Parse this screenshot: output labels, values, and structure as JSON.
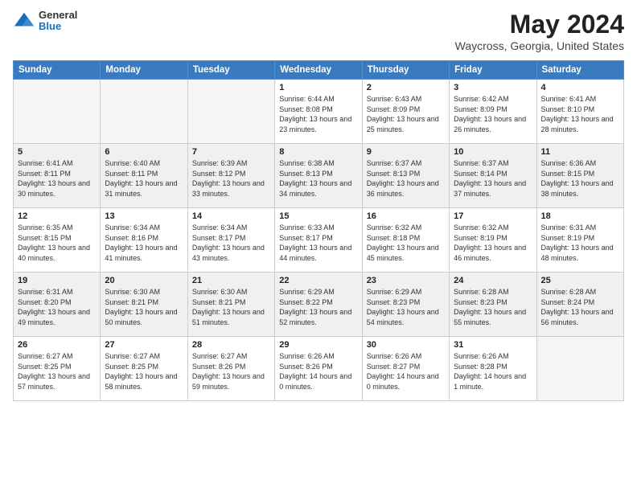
{
  "logo": {
    "general": "General",
    "blue": "Blue"
  },
  "header": {
    "title": "May 2024",
    "subtitle": "Waycross, Georgia, United States"
  },
  "weekdays": [
    "Sunday",
    "Monday",
    "Tuesday",
    "Wednesday",
    "Thursday",
    "Friday",
    "Saturday"
  ],
  "weeks": [
    [
      {
        "day": "",
        "info": ""
      },
      {
        "day": "",
        "info": ""
      },
      {
        "day": "",
        "info": ""
      },
      {
        "day": "1",
        "info": "Sunrise: 6:44 AM\nSunset: 8:08 PM\nDaylight: 13 hours and 23 minutes."
      },
      {
        "day": "2",
        "info": "Sunrise: 6:43 AM\nSunset: 8:09 PM\nDaylight: 13 hours and 25 minutes."
      },
      {
        "day": "3",
        "info": "Sunrise: 6:42 AM\nSunset: 8:09 PM\nDaylight: 13 hours and 26 minutes."
      },
      {
        "day": "4",
        "info": "Sunrise: 6:41 AM\nSunset: 8:10 PM\nDaylight: 13 hours and 28 minutes."
      }
    ],
    [
      {
        "day": "5",
        "info": "Sunrise: 6:41 AM\nSunset: 8:11 PM\nDaylight: 13 hours and 30 minutes."
      },
      {
        "day": "6",
        "info": "Sunrise: 6:40 AM\nSunset: 8:11 PM\nDaylight: 13 hours and 31 minutes."
      },
      {
        "day": "7",
        "info": "Sunrise: 6:39 AM\nSunset: 8:12 PM\nDaylight: 13 hours and 33 minutes."
      },
      {
        "day": "8",
        "info": "Sunrise: 6:38 AM\nSunset: 8:13 PM\nDaylight: 13 hours and 34 minutes."
      },
      {
        "day": "9",
        "info": "Sunrise: 6:37 AM\nSunset: 8:13 PM\nDaylight: 13 hours and 36 minutes."
      },
      {
        "day": "10",
        "info": "Sunrise: 6:37 AM\nSunset: 8:14 PM\nDaylight: 13 hours and 37 minutes."
      },
      {
        "day": "11",
        "info": "Sunrise: 6:36 AM\nSunset: 8:15 PM\nDaylight: 13 hours and 38 minutes."
      }
    ],
    [
      {
        "day": "12",
        "info": "Sunrise: 6:35 AM\nSunset: 8:15 PM\nDaylight: 13 hours and 40 minutes."
      },
      {
        "day": "13",
        "info": "Sunrise: 6:34 AM\nSunset: 8:16 PM\nDaylight: 13 hours and 41 minutes."
      },
      {
        "day": "14",
        "info": "Sunrise: 6:34 AM\nSunset: 8:17 PM\nDaylight: 13 hours and 43 minutes."
      },
      {
        "day": "15",
        "info": "Sunrise: 6:33 AM\nSunset: 8:17 PM\nDaylight: 13 hours and 44 minutes."
      },
      {
        "day": "16",
        "info": "Sunrise: 6:32 AM\nSunset: 8:18 PM\nDaylight: 13 hours and 45 minutes."
      },
      {
        "day": "17",
        "info": "Sunrise: 6:32 AM\nSunset: 8:19 PM\nDaylight: 13 hours and 46 minutes."
      },
      {
        "day": "18",
        "info": "Sunrise: 6:31 AM\nSunset: 8:19 PM\nDaylight: 13 hours and 48 minutes."
      }
    ],
    [
      {
        "day": "19",
        "info": "Sunrise: 6:31 AM\nSunset: 8:20 PM\nDaylight: 13 hours and 49 minutes."
      },
      {
        "day": "20",
        "info": "Sunrise: 6:30 AM\nSunset: 8:21 PM\nDaylight: 13 hours and 50 minutes."
      },
      {
        "day": "21",
        "info": "Sunrise: 6:30 AM\nSunset: 8:21 PM\nDaylight: 13 hours and 51 minutes."
      },
      {
        "day": "22",
        "info": "Sunrise: 6:29 AM\nSunset: 8:22 PM\nDaylight: 13 hours and 52 minutes."
      },
      {
        "day": "23",
        "info": "Sunrise: 6:29 AM\nSunset: 8:23 PM\nDaylight: 13 hours and 54 minutes."
      },
      {
        "day": "24",
        "info": "Sunrise: 6:28 AM\nSunset: 8:23 PM\nDaylight: 13 hours and 55 minutes."
      },
      {
        "day": "25",
        "info": "Sunrise: 6:28 AM\nSunset: 8:24 PM\nDaylight: 13 hours and 56 minutes."
      }
    ],
    [
      {
        "day": "26",
        "info": "Sunrise: 6:27 AM\nSunset: 8:25 PM\nDaylight: 13 hours and 57 minutes."
      },
      {
        "day": "27",
        "info": "Sunrise: 6:27 AM\nSunset: 8:25 PM\nDaylight: 13 hours and 58 minutes."
      },
      {
        "day": "28",
        "info": "Sunrise: 6:27 AM\nSunset: 8:26 PM\nDaylight: 13 hours and 59 minutes."
      },
      {
        "day": "29",
        "info": "Sunrise: 6:26 AM\nSunset: 8:26 PM\nDaylight: 14 hours and 0 minutes."
      },
      {
        "day": "30",
        "info": "Sunrise: 6:26 AM\nSunset: 8:27 PM\nDaylight: 14 hours and 0 minutes."
      },
      {
        "day": "31",
        "info": "Sunrise: 6:26 AM\nSunset: 8:28 PM\nDaylight: 14 hours and 1 minute."
      },
      {
        "day": "",
        "info": ""
      }
    ]
  ]
}
